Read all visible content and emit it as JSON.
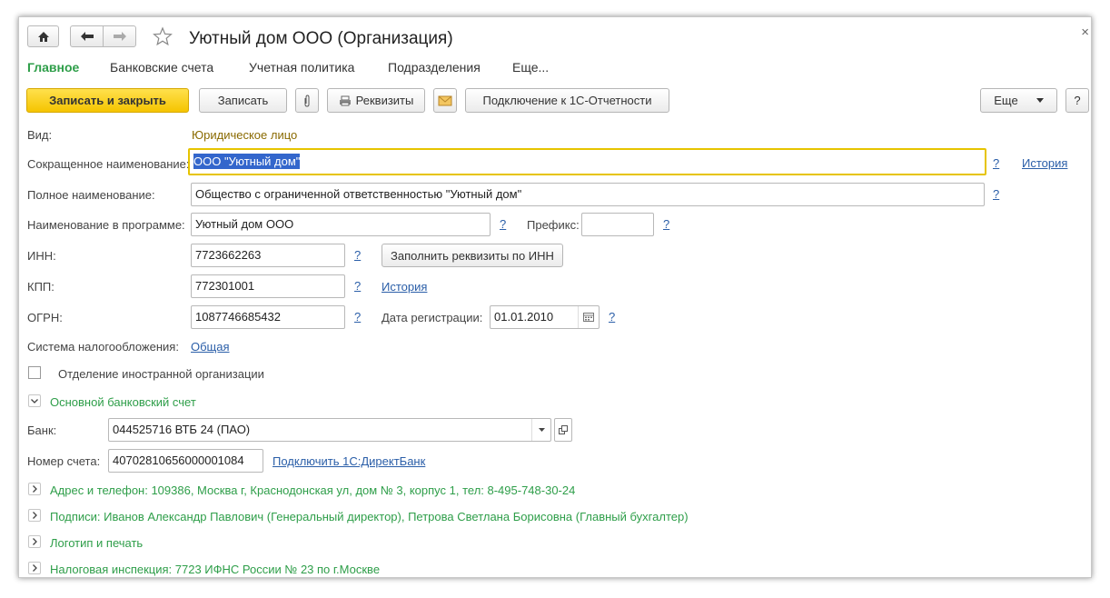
{
  "window": {
    "title": "Уютный дом ООО (Организация)"
  },
  "tabs": [
    "Главное",
    "Банковские счета",
    "Учетная политика",
    "Подразделения",
    "Еще..."
  ],
  "toolbar": {
    "save_close": "Записать и закрыть",
    "save": "Записать",
    "requisites": "Реквизиты",
    "connect": "Подключение к 1С-Отчетности",
    "more": "Еще",
    "help": "?"
  },
  "form": {
    "vid_label": "Вид:",
    "vid_value": "Юридическое лицо",
    "short_name_label": "Сокращенное наименование:",
    "short_name_value": "ООО \"Уютный дом\"",
    "history_label": "История",
    "full_name_label": "Полное наименование:",
    "full_name_value": "Общество с ограниченной ответственностью \"Уютный дом\"",
    "program_name_label": "Наименование в программе:",
    "program_name_value": "Уютный дом ООО",
    "prefix_label": "Префикс:",
    "prefix_value": "",
    "inn_label": "ИНН:",
    "inn_value": "7723662263",
    "fill_by_inn": "Заполнить реквизиты по ИНН",
    "kpp_label": "КПП:",
    "kpp_value": "772301001",
    "kpp_history": "История",
    "ogrn_label": "ОГРН:",
    "ogrn_value": "1087746685432",
    "reg_date_label": "Дата регистрации:",
    "reg_date_value": "01.01.2010",
    "tax_label": "Система налогообложения:",
    "tax_value": "Общая",
    "foreign_label": "Отделение иностранной организации",
    "q": "?"
  },
  "bank": {
    "group_title": "Основной банковский счет",
    "bank_label": "Банк:",
    "bank_value": "044525716 ВТБ 24 (ПАО)",
    "account_label": "Номер счета:",
    "account_value": "40702810656000001084",
    "direct_bank": "Подключить 1С:ДиректБанк"
  },
  "groups": [
    "Адрес и телефон: 109386, Москва г, Краснодонская ул, дом № 3, корпус 1, тел: 8-495-748-30-24",
    "Подписи: Иванов Александр Павлович (Генеральный директор), Петрова Светлана Борисовна (Главный бухгалтер)",
    "Логотип и печать",
    "Налоговая инспекция: 7723 ИФНС России № 23 по г.Москве"
  ],
  "colors": {
    "accent_green": "#2e9e49",
    "primary_button": "#f5c400",
    "link": "#2a5ea8",
    "focus_border": "#e6c400"
  }
}
